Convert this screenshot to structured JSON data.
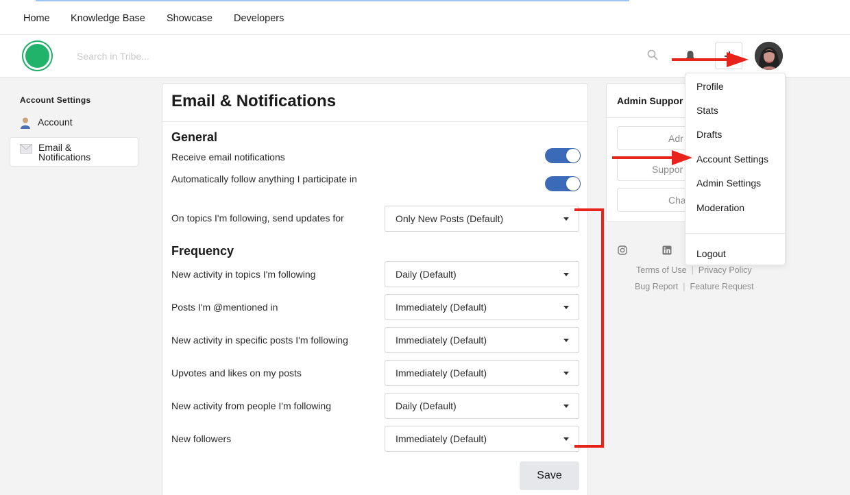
{
  "topnav": {
    "items": [
      {
        "label": "Home"
      },
      {
        "label": "Knowledge Base"
      },
      {
        "label": "Showcase"
      },
      {
        "label": "Developers"
      }
    ]
  },
  "header": {
    "search_placeholder": "Search in Tribe...",
    "icons": [
      "search-icon",
      "bell-icon",
      "plus-icon",
      "avatar"
    ],
    "brand_color": "#22b36b"
  },
  "sidebar": {
    "heading": "Account Settings",
    "items": [
      {
        "label": "Account",
        "icon": "user-icon",
        "active": false
      },
      {
        "label": "Email & Notifications",
        "icon": "envelope-icon",
        "active": true
      }
    ]
  },
  "main": {
    "title": "Email & Notifications",
    "general": {
      "title": "General",
      "rows": [
        {
          "label": "Receive email notifications",
          "type": "toggle",
          "on": true
        },
        {
          "label": "Automatically follow anything I participate in",
          "type": "toggle",
          "on": true
        },
        {
          "label": "On topics I'm following, send updates for",
          "type": "select",
          "value": "Only New Posts (Default)"
        }
      ]
    },
    "frequency": {
      "title": "Frequency",
      "rows": [
        {
          "label": "New activity in topics I'm following",
          "value": "Daily (Default)"
        },
        {
          "label": "Posts I'm @mentioned in",
          "value": "Immediately (Default)"
        },
        {
          "label": "New activity in specific posts I'm following",
          "value": "Immediately (Default)"
        },
        {
          "label": "Upvotes and likes on my posts",
          "value": "Immediately (Default)"
        },
        {
          "label": "New activity from people I'm following",
          "value": "Daily (Default)"
        },
        {
          "label": "New followers",
          "value": "Immediately (Default)"
        }
      ]
    },
    "save_label": "Save",
    "toggle_color": "#3b6bb8"
  },
  "right": {
    "title": "Admin Suppor",
    "buttons": [
      {
        "label": "Adr"
      },
      {
        "label": "Suppor"
      },
      {
        "label": "Cha"
      }
    ],
    "social_icons": [
      "instagram-icon",
      "linkedin-icon"
    ],
    "footer": {
      "terms": "Terms of Use",
      "privacy": "Privacy Policy",
      "bug": "Bug Report",
      "feature": "Feature Request",
      "separator": "|"
    }
  },
  "dropdown": {
    "items": [
      {
        "label": "Profile"
      },
      {
        "label": "Stats"
      },
      {
        "label": "Drafts"
      },
      {
        "label": "Account Settings"
      },
      {
        "label": "Admin Settings"
      },
      {
        "label": "Moderation"
      }
    ],
    "logout_label": "Logout"
  },
  "annotation_color": "#e8231b"
}
